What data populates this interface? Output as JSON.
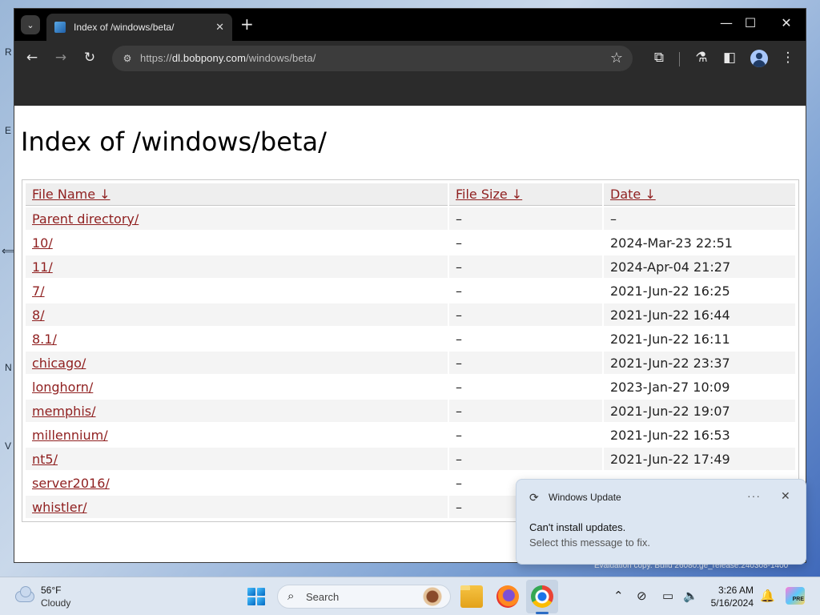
{
  "browser": {
    "tab_title": "Index of /windows/beta/",
    "url_scheme": "https://",
    "url_host": "dl.bobpony.com",
    "url_path": "/windows/beta/"
  },
  "page": {
    "heading": "Index of /windows/beta/",
    "columns": [
      "File Name  ↓",
      "File Size  ↓",
      "Date  ↓"
    ],
    "rows": [
      {
        "name": "Parent directory/",
        "size": "–",
        "date": "–"
      },
      {
        "name": "10/",
        "size": "–",
        "date": "2024-Mar-23 22:51"
      },
      {
        "name": "11/",
        "size": "–",
        "date": "2024-Apr-04 21:27"
      },
      {
        "name": "7/",
        "size": "–",
        "date": "2021-Jun-22 16:25"
      },
      {
        "name": "8/",
        "size": "–",
        "date": "2021-Jun-22 16:44"
      },
      {
        "name": "8.1/",
        "size": "–",
        "date": "2021-Jun-22 16:11"
      },
      {
        "name": "chicago/",
        "size": "–",
        "date": "2021-Jun-22 23:37"
      },
      {
        "name": "longhorn/",
        "size": "–",
        "date": "2023-Jan-27 10:09"
      },
      {
        "name": "memphis/",
        "size": "–",
        "date": "2021-Jun-22 19:07"
      },
      {
        "name": "millennium/",
        "size": "–",
        "date": "2021-Jun-22 16:53"
      },
      {
        "name": "nt5/",
        "size": "–",
        "date": "2021-Jun-22 17:49"
      },
      {
        "name": "server2016/",
        "size": "–",
        "date": ""
      },
      {
        "name": "whistler/",
        "size": "–",
        "date": ""
      }
    ]
  },
  "toast": {
    "app_name": "Windows Update",
    "title": "Can't install updates.",
    "body": "Select this message to fix."
  },
  "desktop": {
    "watermark": "Evaluation copy. Build 26080.ge_release.240308-1400"
  },
  "taskbar": {
    "temperature": "56°F",
    "condition": "Cloudy",
    "search_placeholder": "Search",
    "time": "3:26 AM",
    "date": "5/16/2024"
  },
  "icons": [
    "tab-menu-icon",
    "tab-close-icon",
    "new-tab-icon",
    "minimize-icon",
    "maximize-icon",
    "close-icon",
    "back-icon",
    "forward-icon",
    "reload-icon",
    "site-info-icon",
    "bookmark-star-icon",
    "extensions-icon",
    "labs-icon",
    "sidepanel-icon",
    "profile-icon",
    "menu-icon",
    "sync-icon",
    "more-icon",
    "weather-icon",
    "windows-start-icon",
    "search-icon",
    "file-explorer-icon",
    "firefox-icon",
    "chrome-icon",
    "chevron-up-icon",
    "network-icon",
    "display-icon",
    "volume-icon",
    "bell-icon",
    "copilot-icon"
  ],
  "colors": {
    "link": "#8f1f1f",
    "chrome_dark": "#2b2b2b",
    "taskbar": "#dde6f1",
    "toast_bg": "#dce6f2"
  }
}
